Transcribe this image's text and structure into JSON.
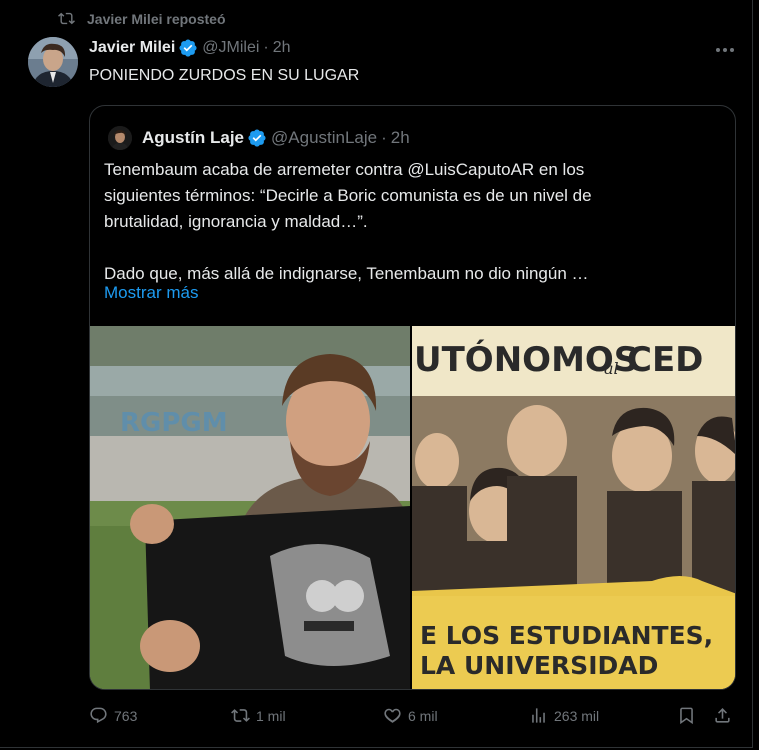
{
  "repost": {
    "label": "Javier Milei reposteó",
    "icon": "repost-icon"
  },
  "tweet": {
    "author_name": "Javier Milei",
    "author_handle": "@JMilei",
    "separator": "·",
    "time": "2h",
    "text": "PONIENDO ZURDOS EN SU LUGAR",
    "verified_color": "#1d9bf0"
  },
  "quote": {
    "author_name": "Agustín Laje",
    "author_handle": "@AgustinLaje",
    "separator": "·",
    "time": "2h",
    "text_lines": [
      "Tenembaum acaba de arremeter contra @LuisCaputoAR en los",
      "siguientes términos: “Decirle a Boric comunista es de un nivel de",
      "brutalidad, ignorancia y maldad…”.",
      "Dado que, más allá de indignarse, Tenembaum no dio ningún …"
    ],
    "show_more": "Mostrar más",
    "media": {
      "left_graffiti": "RGPGM",
      "right_banner_top_a": "UTÓNOMOS",
      "right_banner_top_b": "al",
      "right_banner_top_c": "CED",
      "right_banner_bottom_1": "E LOS ESTUDIANTES,",
      "right_banner_bottom_2": "LA UNIVERSIDAD"
    }
  },
  "actions": {
    "replies": "763",
    "reposts": "1 mil",
    "likes": "6 mil",
    "views": "263 mil"
  },
  "colors": {
    "background": "#000000",
    "text": "#e7e9ea",
    "muted": "#71767b",
    "accent": "#1d9bf0",
    "border": "#2f3336"
  }
}
